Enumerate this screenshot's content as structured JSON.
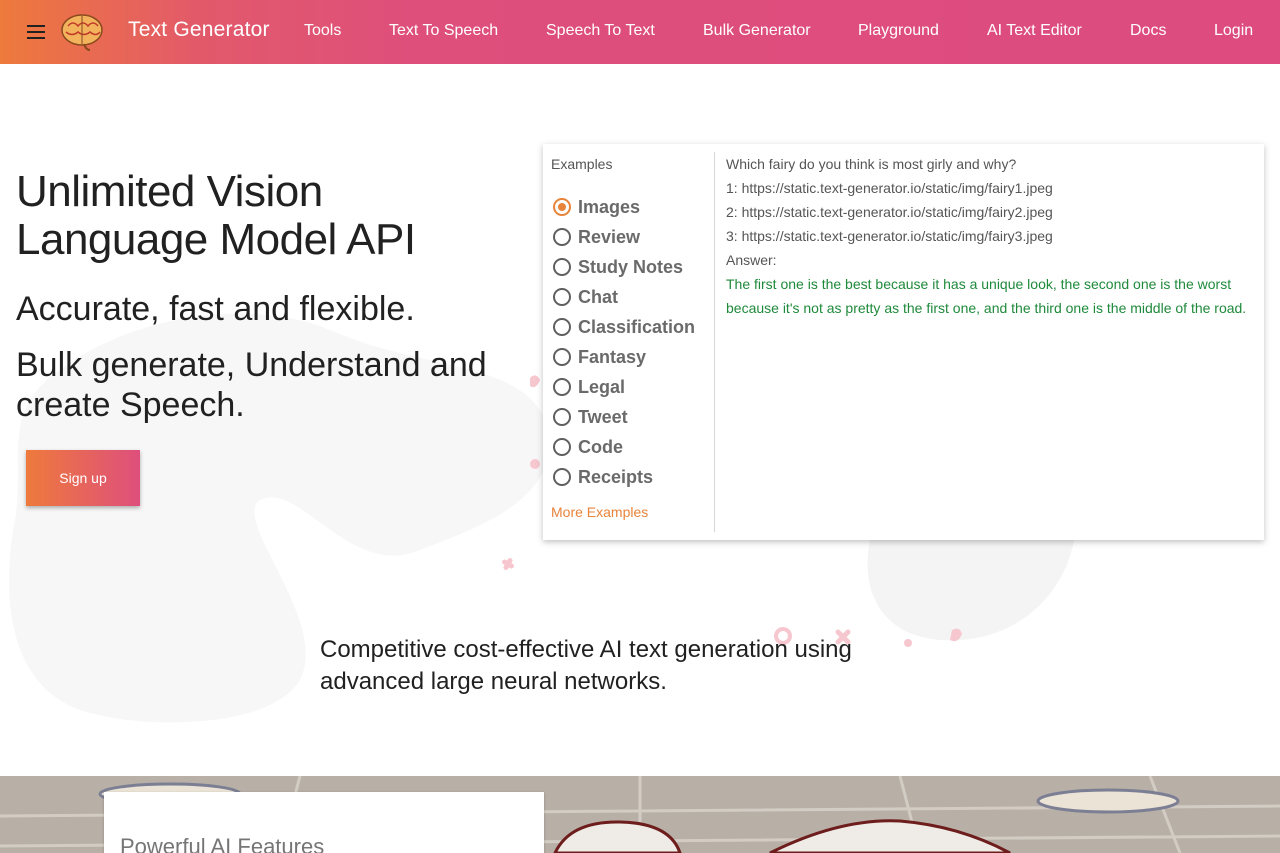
{
  "header": {
    "brand": "Text Generator",
    "nav": [
      "Tools",
      "Text To Speech",
      "Speech To Text",
      "Bulk Generator",
      "Playground",
      "AI Text Editor",
      "Docs",
      "Login"
    ]
  },
  "hero": {
    "title": "Unlimited Vision Language Model API",
    "subtitle1": "Accurate, fast and flexible.",
    "subtitle2": "Bulk generate, Understand and create Speech.",
    "signup_label": "Sign up"
  },
  "examples": {
    "label": "Examples",
    "options": [
      "Images",
      "Review",
      "Study Notes",
      "Chat",
      "Classification",
      "Fantasy",
      "Legal",
      "Tweet",
      "Code",
      "Receipts"
    ],
    "selected": "Images",
    "more_label": "More Examples",
    "prompt_lines": [
      "Which fairy do you think is most girly and why?",
      "1: https://static.text-generator.io/static/img/fairy1.jpeg",
      "2: https://static.text-generator.io/static/img/fairy2.jpeg",
      "3: https://static.text-generator.io/static/img/fairy3.jpeg",
      "Answer:"
    ],
    "answer": "The first one is the best because it has a unique look, the second one is the worst because it's not as pretty as the first one, and the third one is the middle of the road."
  },
  "tagline": "Competitive cost-effective AI text generation using advanced large neural networks.",
  "features": {
    "title": "Powerful AI Features"
  },
  "colors": {
    "accent": "#e8833a",
    "header_start": "#ee7a3c",
    "header_end": "#dd4b7f",
    "answer": "#1f8a3b"
  },
  "icons": {
    "menu": "hamburger-menu-icon",
    "logo": "brain-logo"
  }
}
